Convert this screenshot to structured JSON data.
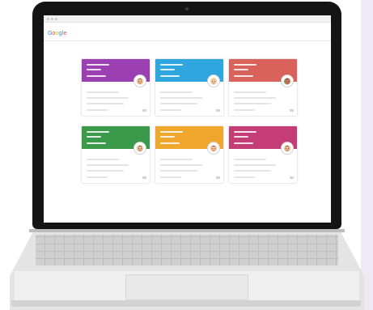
{
  "browser": {
    "logo_text": "Google"
  },
  "colors": {
    "purple": "#9c3fb3",
    "blue": "#2fa6de",
    "red": "#d9625a",
    "green": "#3a9a4a",
    "orange": "#f0a72d",
    "magenta": "#c43d76",
    "logo": [
      "#4285f4",
      "#ea4335",
      "#fbbc05",
      "#4285f4",
      "#34a853",
      "#ea4335"
    ]
  },
  "cards": [
    {
      "color": "#9c3fb3",
      "avatar": "boy-avatar-icon"
    },
    {
      "color": "#2fa6de",
      "avatar": "blonde-girl-avatar-icon"
    },
    {
      "color": "#d9625a",
      "avatar": "dark-hair-avatar-icon"
    },
    {
      "color": "#3a9a4a",
      "avatar": "boy-avatar-icon"
    },
    {
      "color": "#f0a72d",
      "avatar": "girl-avatar-icon"
    },
    {
      "color": "#c43d76",
      "avatar": "boy-avatar-icon"
    }
  ]
}
